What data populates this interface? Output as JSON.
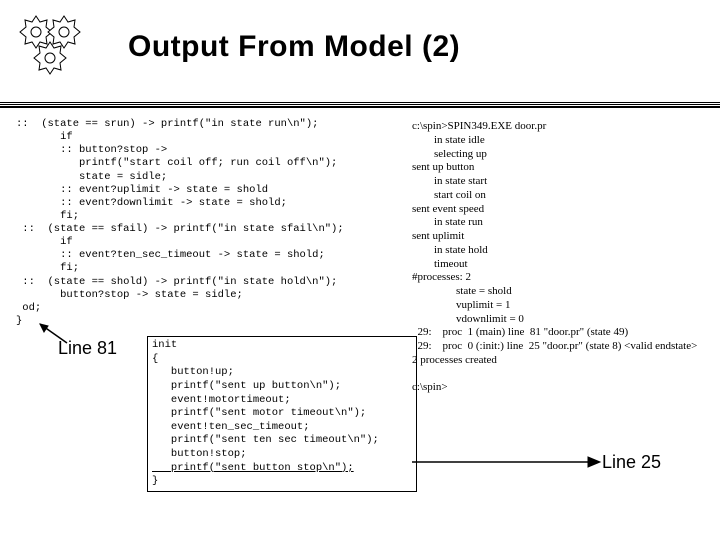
{
  "title": "Output From Model (2)",
  "code_left": "::  (state == srun) -> printf(\"in state run\\n\");\n       if\n       :: button?stop ->\n          printf(\"start coil off; run coil off\\n\");\n          state = sidle;\n       :: event?uplimit -> state = shold\n       :: event?downlimit -> state = shold;\n       fi;\n ::  (state == sfail) -> printf(\"in state sfail\\n\");\n       if\n       :: event?ten_sec_timeout -> state = shold;\n       fi;\n ::  (state == shold) -> printf(\"in state hold\\n\");\n       button?stop -> state = sidle;\n od;\n}",
  "line81_label": "Line 81",
  "init_code_top": "init\n{\n   button!up;\n   printf(\"sent up button\\n\");\n   event!motortimeout;\n   printf(\"sent motor timeout\\n\");\n   event!ten_sec_timeout;\n   printf(\"sent ten sec timeout\\n\");\n   button!stop;",
  "init_code_underline": "   printf(\"sent button stop\\n\");",
  "init_code_bottom": "}",
  "trace_right": "c:\\spin>SPIN349.EXE door.pr\n        in state idle\n        selecting up\nsent up button\n        in state start\n        start coil on\nsent event speed\n        in state run\nsent uplimit\n        in state hold\n        timeout\n#processes: 2\n                state = shold\n                vuplimit = 1\n                vdownlimit = 0\n  29:    proc  1 (main) line  81 \"door.pr\" (state 49)\n  29:    proc  0 (:init:) line  25 \"door.pr\" (state 8) <valid endstate>\n2 processes created\n\nc:\\spin>",
  "line25_label": "Line 25"
}
